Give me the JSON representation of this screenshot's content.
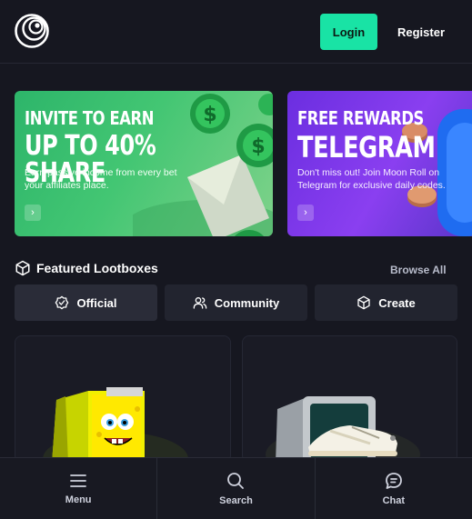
{
  "header": {
    "login_label": "Login",
    "register_label": "Register"
  },
  "banners": [
    {
      "title_line1": "INVITE TO EARN",
      "title_line2": "UP TO 40% SHARE",
      "description": "Earn passive income from every bet your affiliates place."
    },
    {
      "title_line1": "FREE REWARDS",
      "title_line2": "TELEGRAM",
      "description": "Don't miss out! Join Moon Roll on Telegram for exclusive daily codes."
    }
  ],
  "featured": {
    "title": "Featured Lootboxes",
    "browse_all": "Browse All",
    "tabs": [
      {
        "label": "Official",
        "icon": "badge-check-icon"
      },
      {
        "label": "Community",
        "icon": "users-icon"
      },
      {
        "label": "Create",
        "icon": "box-icon"
      }
    ]
  },
  "bottom_nav": [
    {
      "label": "Menu",
      "icon": "menu-icon"
    },
    {
      "label": "Search",
      "icon": "search-icon"
    },
    {
      "label": "Chat",
      "icon": "chat-icon"
    }
  ],
  "colors": {
    "accent": "#19e3a5",
    "background": "#161720",
    "surface": "#22242f"
  }
}
